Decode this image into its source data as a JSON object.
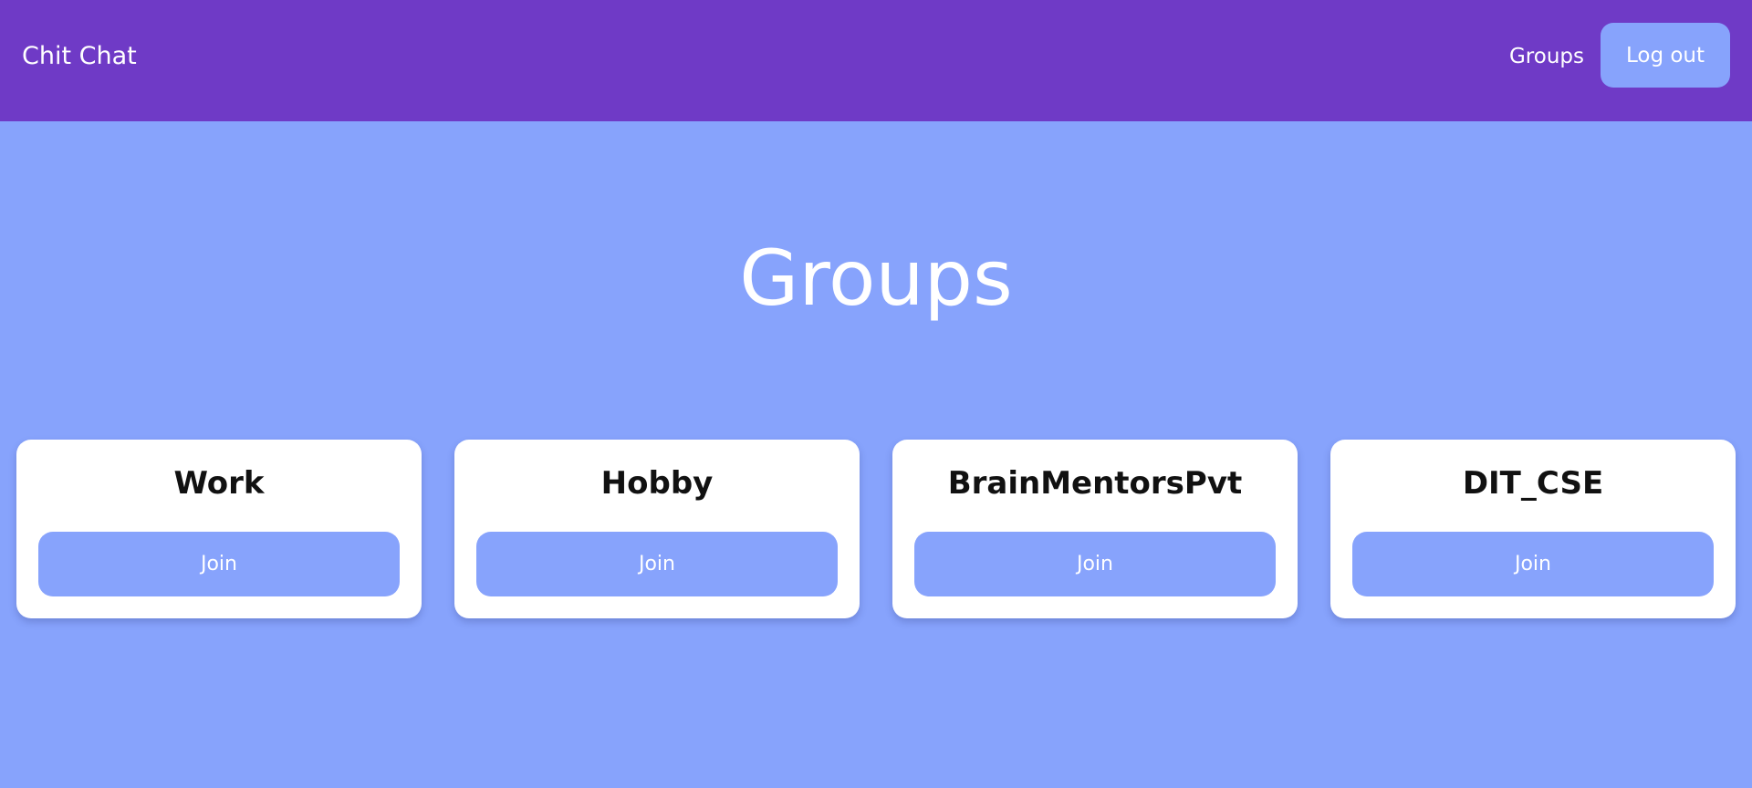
{
  "navbar": {
    "brand": "Chit Chat",
    "groups_link": "Groups",
    "logout_label": "Log out"
  },
  "page": {
    "title": "Groups"
  },
  "groups": [
    {
      "name": "Work",
      "join_label": "Join"
    },
    {
      "name": "Hobby",
      "join_label": "Join"
    },
    {
      "name": "BrainMentorsPvt",
      "join_label": "Join"
    },
    {
      "name": "DIT_CSE",
      "join_label": "Join"
    }
  ],
  "colors": {
    "navbar": "#6f3ac6",
    "background": "#87a3fc",
    "card": "#ffffff",
    "button": "#87a3fc"
  }
}
